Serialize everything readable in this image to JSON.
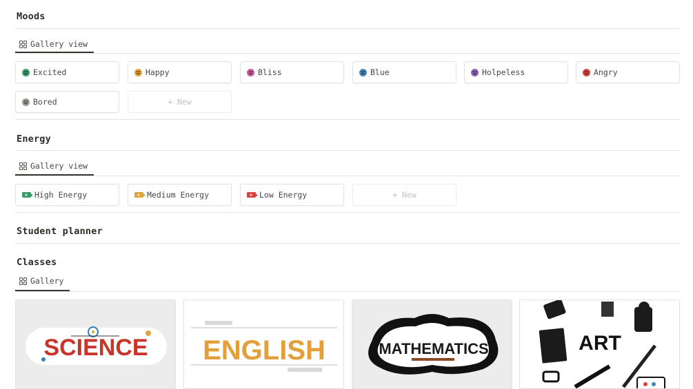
{
  "moods": {
    "title": "Moods",
    "view_label": "Gallery view",
    "items": [
      {
        "label": "Excited",
        "icon": "green-smile-emoji-icon",
        "color": "#3a9a6a"
      },
      {
        "label": "Happy",
        "icon": "orange-smile-emoji-icon",
        "color": "#e0a23a"
      },
      {
        "label": "Bliss",
        "icon": "pink-smile-emoji-icon",
        "color": "#c75a9c"
      },
      {
        "label": "Blue",
        "icon": "blue-sad-emoji-icon",
        "color": "#3f86b8"
      },
      {
        "label": "Holpeless",
        "icon": "purple-sad-emoji-icon",
        "color": "#8d5fb5"
      },
      {
        "label": "Angry",
        "icon": "red-angry-emoji-icon",
        "color": "#d8443c"
      },
      {
        "label": "Bored",
        "icon": "gray-neutral-emoji-icon",
        "color": "#9a9893"
      }
    ],
    "new_label": "+ New"
  },
  "energy": {
    "title": "Energy",
    "view_label": "Gallery view",
    "items": [
      {
        "label": "High Energy",
        "icon": "green-battery-icon",
        "color": "#3a9a6a"
      },
      {
        "label": "Medium Energy",
        "icon": "orange-battery-icon",
        "color": "#e0a23a"
      },
      {
        "label": "Low Energy",
        "icon": "red-battery-icon",
        "color": "#d8443c"
      }
    ],
    "new_label": "+ New"
  },
  "student_planner": {
    "title": "Student planner"
  },
  "classes": {
    "title": "Classes",
    "view_label": "Gallery",
    "items": [
      {
        "label": "SCIENCE",
        "icon": "science-cover-image"
      },
      {
        "label": "ENGLISH",
        "icon": "english-cover-image"
      },
      {
        "label": "MATHEMATICS",
        "icon": "mathematics-cover-image"
      },
      {
        "label": "ART",
        "icon": "art-cover-image"
      }
    ]
  }
}
